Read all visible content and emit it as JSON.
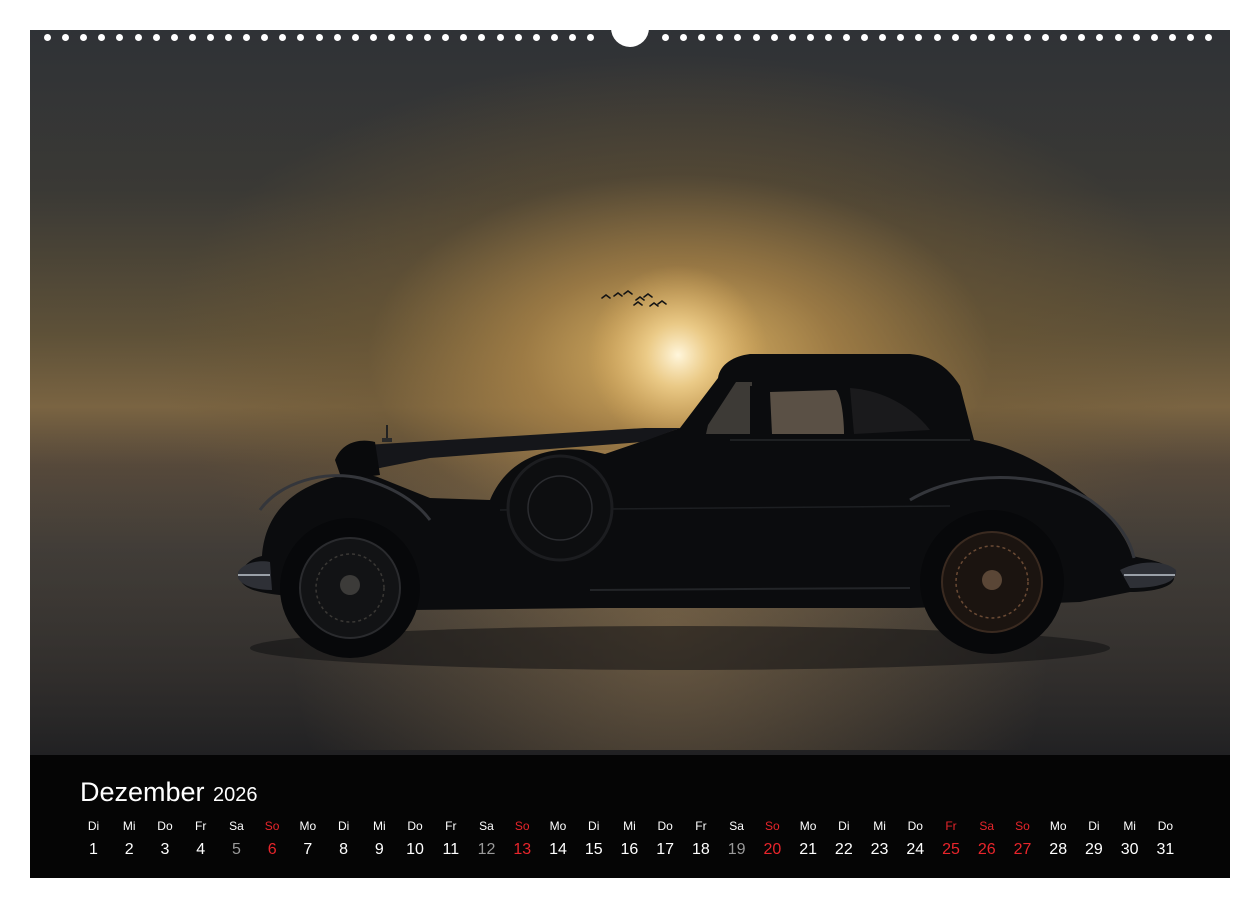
{
  "calendar": {
    "month": "Dezember",
    "year": "2026",
    "days": [
      {
        "wd": "Di",
        "d": "1",
        "type": "weekday"
      },
      {
        "wd": "Mi",
        "d": "2",
        "type": "weekday"
      },
      {
        "wd": "Do",
        "d": "3",
        "type": "weekday"
      },
      {
        "wd": "Fr",
        "d": "4",
        "type": "weekday"
      },
      {
        "wd": "Sa",
        "d": "5",
        "type": "saturday"
      },
      {
        "wd": "So",
        "d": "6",
        "type": "sunday"
      },
      {
        "wd": "Mo",
        "d": "7",
        "type": "weekday"
      },
      {
        "wd": "Di",
        "d": "8",
        "type": "weekday"
      },
      {
        "wd": "Mi",
        "d": "9",
        "type": "weekday"
      },
      {
        "wd": "Do",
        "d": "10",
        "type": "weekday"
      },
      {
        "wd": "Fr",
        "d": "11",
        "type": "weekday"
      },
      {
        "wd": "Sa",
        "d": "12",
        "type": "saturday"
      },
      {
        "wd": "So",
        "d": "13",
        "type": "sunday"
      },
      {
        "wd": "Mo",
        "d": "14",
        "type": "weekday"
      },
      {
        "wd": "Di",
        "d": "15",
        "type": "weekday"
      },
      {
        "wd": "Mi",
        "d": "16",
        "type": "weekday"
      },
      {
        "wd": "Do",
        "d": "17",
        "type": "weekday"
      },
      {
        "wd": "Fr",
        "d": "18",
        "type": "weekday"
      },
      {
        "wd": "Sa",
        "d": "19",
        "type": "saturday"
      },
      {
        "wd": "So",
        "d": "20",
        "type": "sunday"
      },
      {
        "wd": "Mo",
        "d": "21",
        "type": "weekday"
      },
      {
        "wd": "Di",
        "d": "22",
        "type": "weekday"
      },
      {
        "wd": "Mi",
        "d": "23",
        "type": "weekday"
      },
      {
        "wd": "Do",
        "d": "24",
        "type": "weekday"
      },
      {
        "wd": "Fr",
        "d": "25",
        "type": "holiday"
      },
      {
        "wd": "Sa",
        "d": "26",
        "type": "holiday"
      },
      {
        "wd": "So",
        "d": "27",
        "type": "sunday"
      },
      {
        "wd": "Mo",
        "d": "28",
        "type": "weekday"
      },
      {
        "wd": "Di",
        "d": "29",
        "type": "weekday"
      },
      {
        "wd": "Mi",
        "d": "30",
        "type": "weekday"
      },
      {
        "wd": "Do",
        "d": "31",
        "type": "weekday"
      }
    ]
  },
  "colors": {
    "holiday_red": "#e8252b",
    "saturday_date_gray": "#9a9a9a",
    "band_black": "#050505"
  },
  "image": {
    "subject": "vintage-car-silhouette",
    "icon": "birds-icon"
  }
}
